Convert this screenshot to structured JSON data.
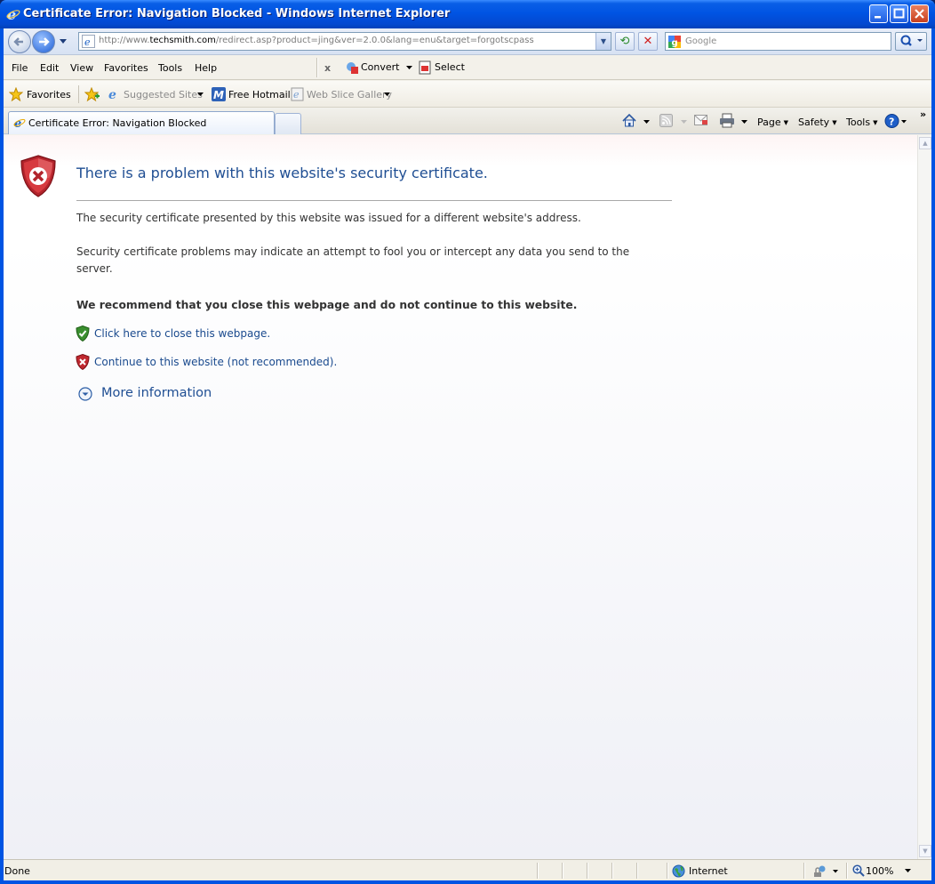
{
  "window": {
    "title": "Certificate Error: Navigation Blocked - Windows Internet Explorer"
  },
  "address_bar": {
    "url_prefix": "http://www.",
    "url_domain": "techsmith.com",
    "url_path": "/redirect.asp?product=jing&ver=2.0.0&lang=enu&target=forgotscpass"
  },
  "search": {
    "placeholder": "Google"
  },
  "menu": {
    "items": [
      "File",
      "Edit",
      "View",
      "Favorites",
      "Tools",
      "Help"
    ],
    "convert_label": "Convert",
    "select_label": "Select"
  },
  "favorites_bar": {
    "favorites_label": "Favorites",
    "suggested_sites": "Suggested Sites",
    "free_hotmail": "Free Hotmail",
    "web_slice_gallery": "Web Slice Gallery"
  },
  "tabs": [
    {
      "label": "Certificate Error: Navigation Blocked"
    }
  ],
  "command_bar": {
    "page": "Page",
    "safety": "Safety",
    "tools": "Tools"
  },
  "content": {
    "heading": "There is a problem with this website's security certificate.",
    "para1": "The security certificate presented by this website was issued for a different website's address.",
    "para2": "Security certificate problems may indicate an attempt to fool you or intercept any data you send to the server.",
    "recommend": "We recommend that you close this webpage and do not continue to this website.",
    "close_link": "Click here to close this webpage.",
    "continue_link": "Continue to this website (not recommended).",
    "more_info": "More information"
  },
  "status_bar": {
    "text": "Done",
    "zone": "Internet",
    "zoom": "100%"
  },
  "colors": {
    "title_blue": "#0054e3",
    "link_blue": "#1a4a8e",
    "heading_blue": "#1f4e93",
    "error_red": "#c8242b"
  }
}
